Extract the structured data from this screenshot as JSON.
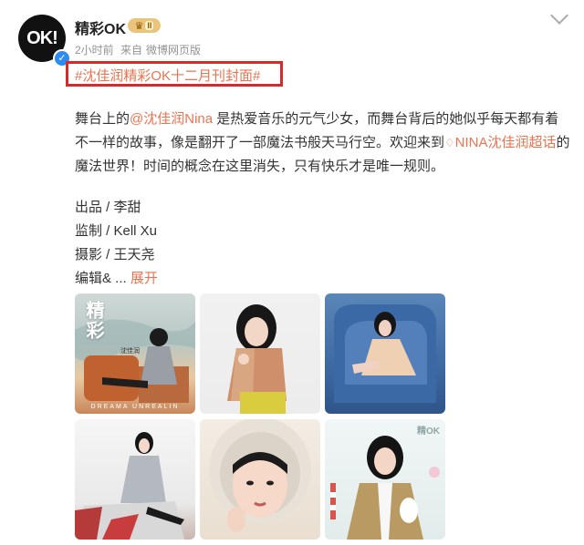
{
  "header": {
    "avatar_text": "OK!",
    "username": "精彩OK",
    "vip_level": "II",
    "time": "2小时前",
    "source_prefix": "来自",
    "source": "微博网页版"
  },
  "post": {
    "hashtag": "#沈佳润精彩OK十二月刊封面#",
    "text_part1": "舞台上的",
    "mention": "@沈佳润Nina",
    "text_part2": " 是热爱音乐的元气少女，而舞台背后的她似乎每天都有着不一样的故事，像是翻开了一部魔法书般天马行空。欢迎来到",
    "topic": "NINA沈佳润超话",
    "text_part3": "的魔法世界！时间的概念在这里消失，只有快乐才是唯一规则。",
    "credits": [
      "出品 / 李甜",
      "监制 / Kell Xu",
      "摄影 / 王天尧"
    ],
    "credits_last": "编辑& ...",
    "expand_label": "展开"
  },
  "photos": {
    "p1_vertical_text": "精彩",
    "p1_name": "沈佳润",
    "p1_caption": "DREAMA UNREALIN",
    "p6_text": "精OK"
  },
  "colors": {
    "link": "#eb7350",
    "highlight_box": "#d62b2b",
    "meta": "#939393"
  },
  "icons": [
    "crown-icon",
    "verified-icon",
    "chevron-down-icon",
    "topic-diamond-icon"
  ]
}
